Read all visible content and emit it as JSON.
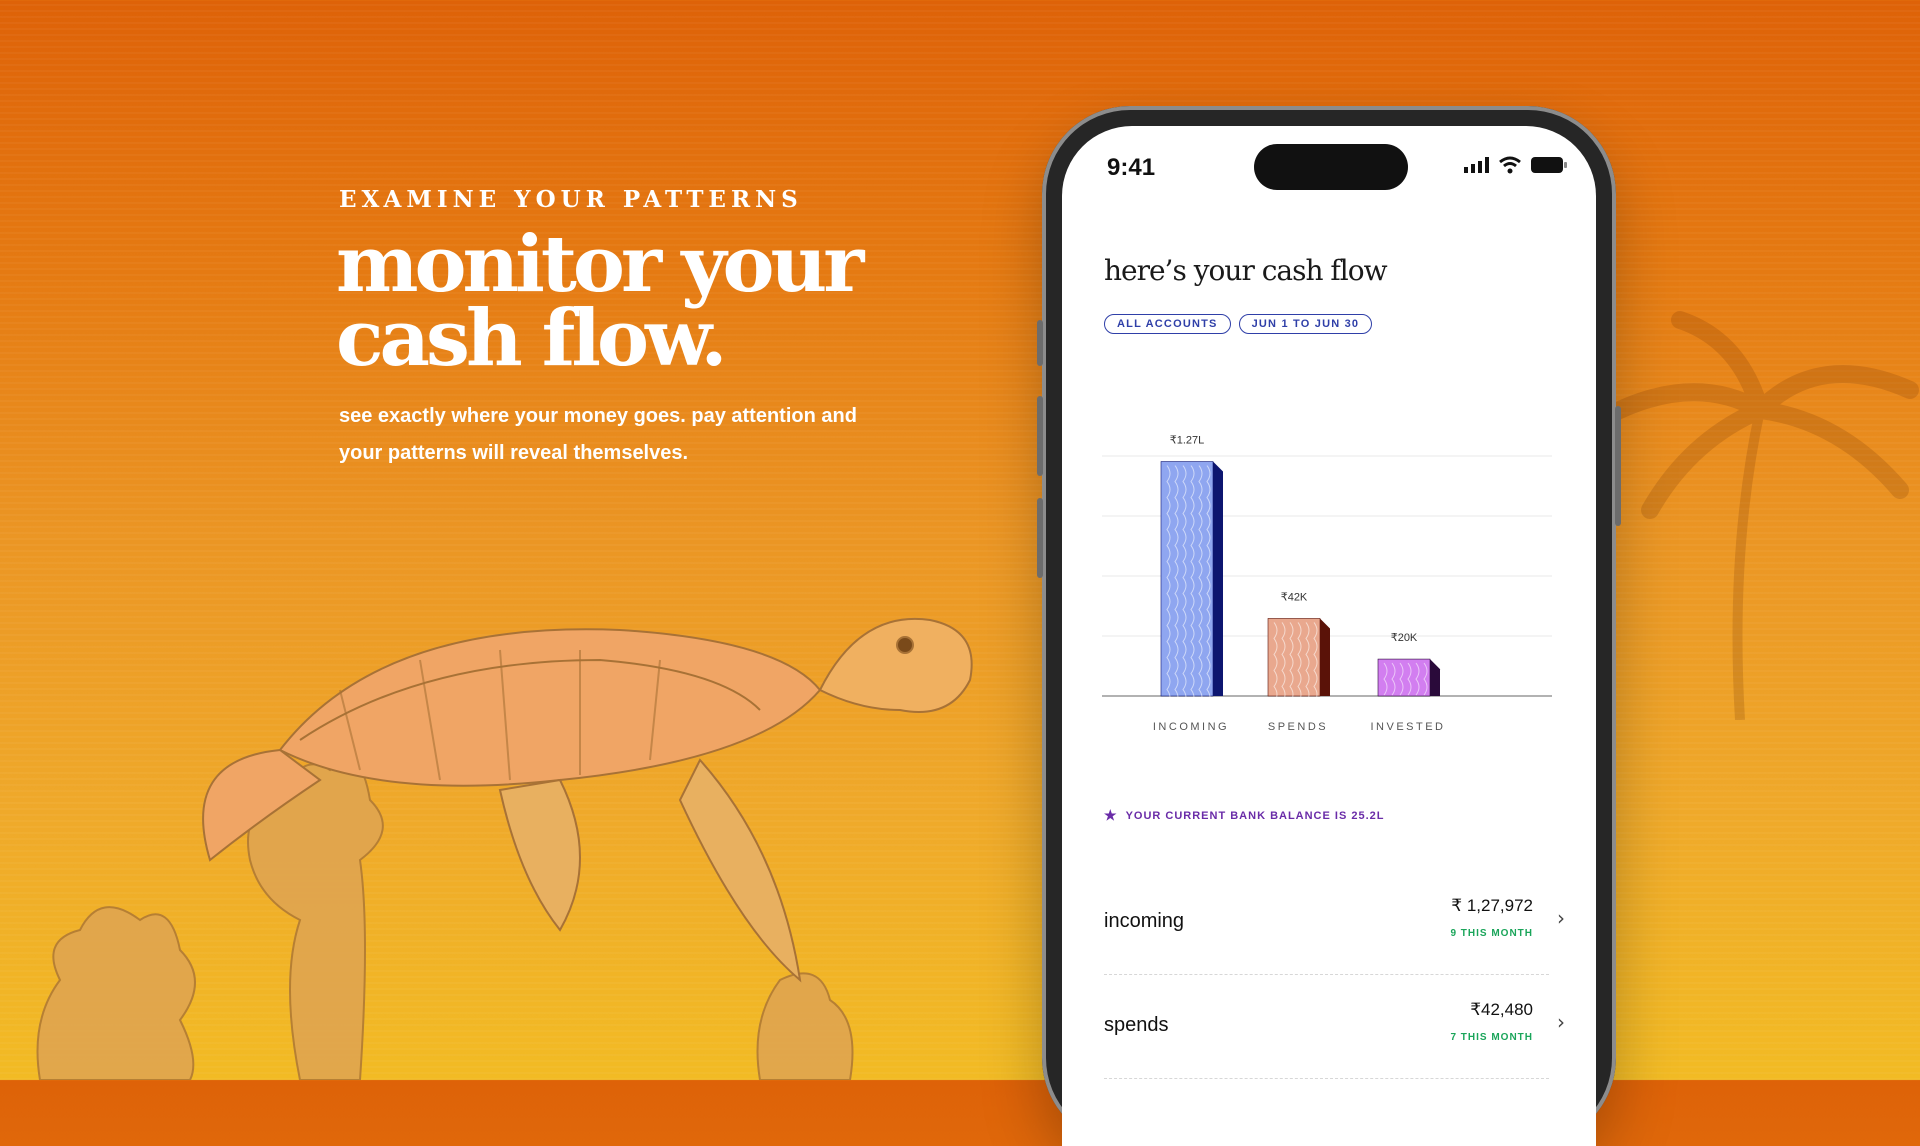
{
  "hero": {
    "eyebrow": "EXAMINE YOUR PATTERNS",
    "headline": "monitor your cash flow.",
    "subtext": "see exactly where your money goes. pay attention and your patterns will reveal themselves."
  },
  "status_bar": {
    "time": "9:41",
    "icons": [
      "signal-icon",
      "wifi-icon",
      "battery-icon"
    ]
  },
  "screen": {
    "title": "here’s your cash flow",
    "filters": [
      "ALL ACCOUNTS",
      "JUN 1 TO JUN 30"
    ],
    "balance_text": "YOUR CURRENT BANK BALANCE IS 25.2L",
    "rows": [
      {
        "label": "incoming",
        "amount": "₹ 1,27,972",
        "count": "9 THIS MONTH"
      },
      {
        "label": "spends",
        "amount": "₹42,480",
        "count": "7 THIS MONTH"
      }
    ]
  },
  "colors": {
    "accent_blue": "#2f3fa8",
    "balance_purple": "#6a2ca8",
    "count_green": "#1aa55a"
  },
  "chart_data": {
    "type": "bar",
    "categories": [
      "INCOMING",
      "SPENDS",
      "INVESTED"
    ],
    "values": [
      127000,
      42000,
      20000
    ],
    "data_labels": [
      "₹1.27L",
      "₹42K",
      "₹20K"
    ],
    "colors": [
      "#8fa6f0",
      "#e9a88e",
      "#d27ef0"
    ],
    "shadow_colors": [
      "#0d1670",
      "#5a1208",
      "#2a0a3a"
    ],
    "ylim": [
      0,
      130000
    ],
    "grid": true
  }
}
